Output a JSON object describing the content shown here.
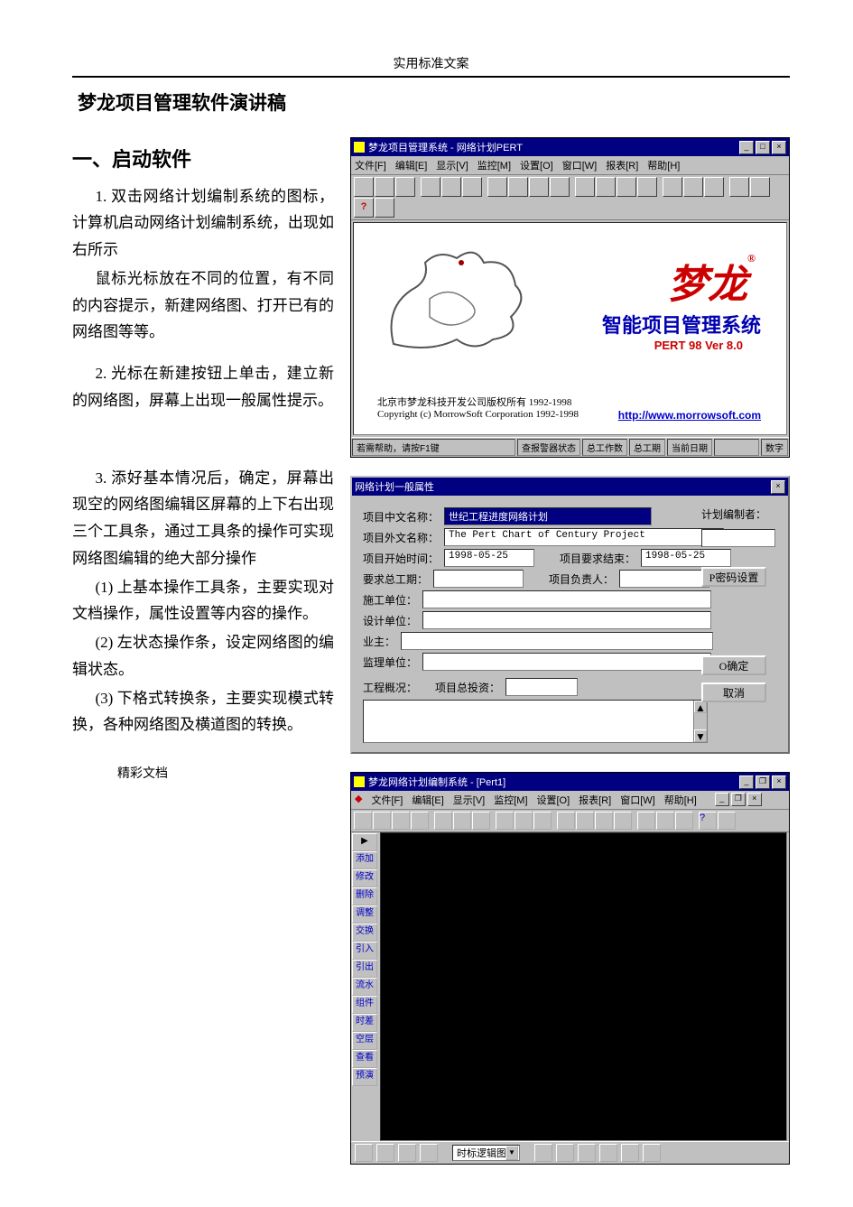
{
  "page_header": "实用标准文案",
  "doc_title": "梦龙项目管理软件演讲稿",
  "section_heading": "一、启动软件",
  "paragraphs": {
    "p1": "1. 双击网络计划编制系统的图标，计算机启动网络计划编制系统，出现如右所示",
    "p1b": "鼠标光标放在不同的位置，有不同的内容提示，新建网络图、打开已有的网络图等等。",
    "p2": "2. 光标在新建按钮上单击，建立新的网络图，屏幕上出现一般属性提示。",
    "p3": "3. 添好基本情况后，确定，屏幕出现空的网络图编辑区屏幕的上下右出现三个工具条，通过工具条的操作可实现网络图编辑的绝大部分操作",
    "p3a": "(1) 上基本操作工具条，主要实现对文档操作，属性设置等内容的操作。",
    "p3b": "(2) 左状态操作条，设定网络图的编辑状态。",
    "p3c": "(3) 下格式转换条，主要实现模式转换，各种网络图及横道图的转换。"
  },
  "footer": "精彩文档",
  "win1": {
    "title": "梦龙项目管理系统 - 网络计划PERT",
    "menu": [
      "文件[F]",
      "编辑[E]",
      "显示[V]",
      "监控[M]",
      "设置[O]",
      "窗口[W]",
      "报表[R]",
      "帮助[H]"
    ],
    "brand": "梦龙",
    "brand_sup": "®",
    "subtitle": "智能项目管理系统",
    "version": "PERT 98   Ver 8.0",
    "copyright1": "北京市梦龙科技开发公司版权所有 1992-1998",
    "copyright2": "Copyright (c) MorrowSoft Corporation 1992-1998",
    "url": "http://www.morrowsoft.com",
    "status": [
      "若需帮助，请按F1键",
      "查报警器状态",
      "总工作数",
      "总工期",
      "当前日期",
      "数字"
    ]
  },
  "win2": {
    "title": "网络计划一般属性",
    "labels": {
      "l1": "项目中文名称：",
      "l2": "项目外文名称：",
      "l3": "项目开始时间：",
      "l4": "项目要求结束：",
      "l5": "要求总工期：",
      "l6": "项目负责人：",
      "l7": "施工单位：",
      "l8": "设计单位：",
      "l9": "业主：",
      "l10": "监理单位：",
      "l11": "工程概况：",
      "l12": "项目总投资：",
      "l13": "计划编制者："
    },
    "values": {
      "name_cn": "世纪工程进度网络计划",
      "name_en": "The Pert Chart of Century Project",
      "start": "1998-05-25",
      "end": "1998-05-25"
    },
    "buttons": {
      "pwd": "P密码设置",
      "ok": "O确定",
      "cancel": "取消"
    }
  },
  "win3": {
    "title": "梦龙网络计划编制系统 - [Pert1]",
    "menu": [
      "文件[F]",
      "编辑[E]",
      "显示[V]",
      "监控[M]",
      "设置[O]",
      "报表[R]",
      "窗口[W]",
      "帮助[H]"
    ],
    "sidebtns": [
      "添加",
      "修改",
      "删除",
      "调整",
      "交换",
      "引入",
      "引出",
      "流水",
      "组件",
      "时差",
      "空层",
      "查看",
      "预演"
    ],
    "bottom_label": "时标逻辑图",
    "bottom_modes": [
      "◀",
      "◀",
      "◀"
    ]
  }
}
